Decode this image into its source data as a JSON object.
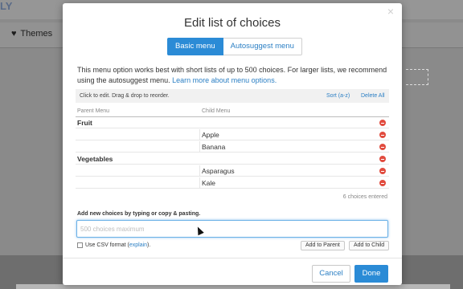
{
  "background": {
    "logo_text": "LY",
    "themes_label": "Themes"
  },
  "modal": {
    "title": "Edit list of choices",
    "close_symbol": "×",
    "tabs": [
      {
        "label": "Basic menu",
        "active": true
      },
      {
        "label": "Autosuggest menu",
        "active": false
      }
    ],
    "intro_text": "This menu option works best with short lists of up to 500 choices. For larger lists, we recommend using the autosuggest menu.",
    "intro_link": "Learn more about menu options.",
    "info_bar": {
      "hint": "Click to edit. Drag & drop to reorder.",
      "sort_label": "Sort (a-z)",
      "delete_all_label": "Delete All"
    },
    "columns": {
      "parent": "Parent Menu",
      "child": "Child Menu"
    },
    "rows": [
      {
        "type": "parent",
        "label": "Fruit"
      },
      {
        "type": "child",
        "label": "Apple"
      },
      {
        "type": "child",
        "label": "Banana"
      },
      {
        "type": "parent",
        "label": "Vegetables"
      },
      {
        "type": "child",
        "label": "Asparagus"
      },
      {
        "type": "child",
        "label": "Kale"
      }
    ],
    "count_text": "6 choices entered",
    "add_label": "Add new choices by typing or copy & pasting.",
    "add_placeholder": "500 choices maximum",
    "add_value": "",
    "csv": {
      "label": "Use CSV format (",
      "link": "explain",
      "suffix": ").",
      "checked": false
    },
    "add_to_parent_label": "Add to Parent",
    "add_to_child_label": "Add to Child",
    "cancel_label": "Cancel",
    "done_label": "Done"
  },
  "colors": {
    "accent": "#2b8bd6",
    "link": "#2b7fc4",
    "remove": "#e14b3e"
  }
}
